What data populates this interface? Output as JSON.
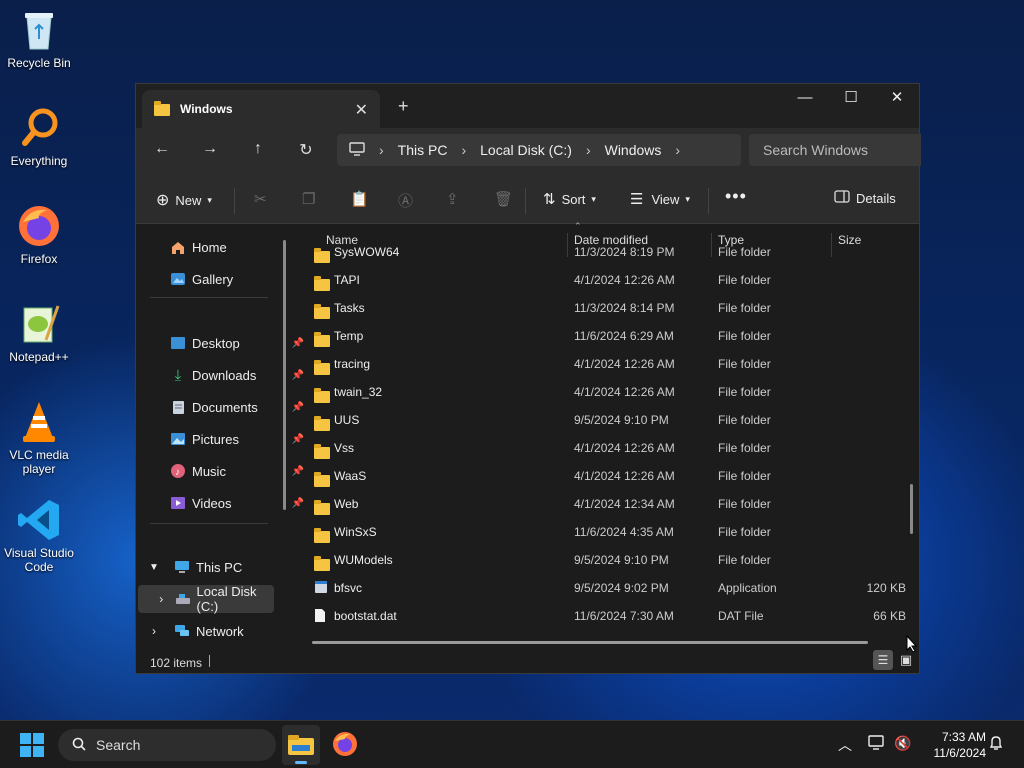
{
  "desktop": {
    "icons": [
      {
        "label": "Recycle Bin"
      },
      {
        "label": "Everything"
      },
      {
        "label": "Firefox"
      },
      {
        "label": "Notepad++"
      },
      {
        "label": "VLC media player"
      },
      {
        "label": "Visual Studio Code"
      }
    ]
  },
  "window": {
    "tab_title": "Windows",
    "address": {
      "root": "This PC",
      "drive": "Local Disk (C:)",
      "folder": "Windows"
    },
    "search_placeholder": "Search Windows",
    "toolbar": {
      "new": "New",
      "sort": "Sort",
      "view": "View",
      "details": "Details"
    },
    "sidebar": {
      "home": "Home",
      "gallery": "Gallery",
      "desktop": "Desktop",
      "downloads": "Downloads",
      "documents": "Documents",
      "pictures": "Pictures",
      "music": "Music",
      "videos": "Videos",
      "this_pc": "This PC",
      "local_disk": "Local Disk (C:)",
      "network": "Network"
    },
    "columns": {
      "name": "Name",
      "date": "Date modified",
      "type": "Type",
      "size": "Size"
    },
    "files": [
      {
        "name": "SysWOW64",
        "date": "11/3/2024 8:19 PM",
        "type": "File folder",
        "size": "",
        "kind": "folder"
      },
      {
        "name": "TAPI",
        "date": "4/1/2024 12:26 AM",
        "type": "File folder",
        "size": "",
        "kind": "folder"
      },
      {
        "name": "Tasks",
        "date": "11/3/2024 8:14 PM",
        "type": "File folder",
        "size": "",
        "kind": "folder"
      },
      {
        "name": "Temp",
        "date": "11/6/2024 6:29 AM",
        "type": "File folder",
        "size": "",
        "kind": "folder"
      },
      {
        "name": "tracing",
        "date": "4/1/2024 12:26 AM",
        "type": "File folder",
        "size": "",
        "kind": "folder"
      },
      {
        "name": "twain_32",
        "date": "4/1/2024 12:26 AM",
        "type": "File folder",
        "size": "",
        "kind": "folder"
      },
      {
        "name": "UUS",
        "date": "9/5/2024 9:10 PM",
        "type": "File folder",
        "size": "",
        "kind": "folder"
      },
      {
        "name": "Vss",
        "date": "4/1/2024 12:26 AM",
        "type": "File folder",
        "size": "",
        "kind": "folder"
      },
      {
        "name": "WaaS",
        "date": "4/1/2024 12:26 AM",
        "type": "File folder",
        "size": "",
        "kind": "folder"
      },
      {
        "name": "Web",
        "date": "4/1/2024 12:34 AM",
        "type": "File folder",
        "size": "",
        "kind": "folder"
      },
      {
        "name": "WinSxS",
        "date": "11/6/2024 4:35 AM",
        "type": "File folder",
        "size": "",
        "kind": "folder"
      },
      {
        "name": "WUModels",
        "date": "9/5/2024 9:10 PM",
        "type": "File folder",
        "size": "",
        "kind": "folder"
      },
      {
        "name": "bfsvc",
        "date": "9/5/2024 9:02 PM",
        "type": "Application",
        "size": "120 KB",
        "kind": "app"
      },
      {
        "name": "bootstat.dat",
        "date": "11/6/2024 7:30 AM",
        "type": "DAT File",
        "size": "66 KB",
        "kind": "file"
      }
    ],
    "status": "102 items"
  },
  "taskbar": {
    "search_placeholder": "Search",
    "time": "7:33 AM",
    "date": "11/6/2024"
  },
  "colors": {
    "accent": "#0078d4",
    "folder": "#f5c542"
  }
}
